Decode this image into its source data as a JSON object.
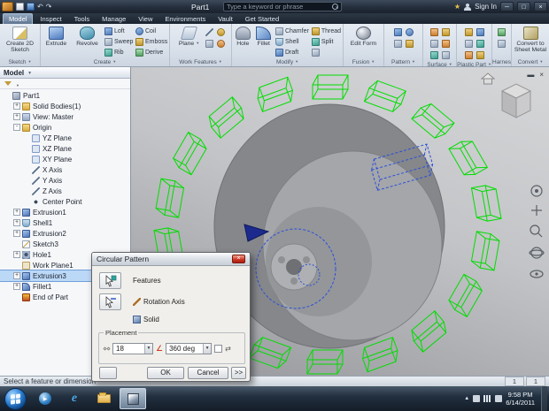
{
  "window": {
    "title": "Part1",
    "search_placeholder": "Type a keyword or phrase",
    "sign_in": "Sign In"
  },
  "icons": {
    "window_min": "─",
    "window_max": "□",
    "window_close": "×",
    "doc_min": "▬",
    "doc_close": "×",
    "undo": "↶",
    "redo": "↷",
    "star": "★",
    "dialog_close": "×",
    "diamonds": "⋄⋄",
    "angle": "∠",
    "flip_arrows": "⇄",
    "combo_arrow": "▼",
    "tray_expand": "▲",
    "play": "▶"
  },
  "tabs": [
    {
      "label": "Model",
      "active": true
    },
    {
      "label": "Inspect"
    },
    {
      "label": "Tools"
    },
    {
      "label": "Manage"
    },
    {
      "label": "View"
    },
    {
      "label": "Environments"
    },
    {
      "label": "Vault"
    },
    {
      "label": "Get Started"
    }
  ],
  "ribbon": {
    "sketch": {
      "label": "Sketch",
      "create_2d_sketch": "Create 2D Sketch"
    },
    "create": {
      "label": "Create",
      "extrude": "Extrude",
      "revolve": "Revolve",
      "loft": "Loft",
      "sweep": "Sweep",
      "rib": "Rib",
      "coil": "Coil",
      "emboss": "Emboss",
      "derive": "Derive"
    },
    "work_features": {
      "label": "Work Features",
      "plane": "Plane"
    },
    "modify": {
      "label": "Modify",
      "hole": "Hole",
      "fillet": "Fillet",
      "chamfer": "Chamfer",
      "thread": "Thread",
      "shell": "Shell",
      "split": "Split",
      "draft": "Draft"
    },
    "fusion": {
      "label": "Fusion",
      "edit_form": "Edit Form"
    },
    "pattern": {
      "label": "Pattern"
    },
    "surface": {
      "label": "Surface"
    },
    "plastic": {
      "label": "Plastic Part"
    },
    "harness": {
      "label": "Harness"
    },
    "convert": {
      "label": "Convert",
      "sheet_metal": "Convert to Sheet Metal"
    }
  },
  "browser": {
    "header": "Model",
    "items": [
      {
        "label": "Part1",
        "level": 0,
        "expand": "",
        "icon": "part"
      },
      {
        "label": "Solid Bodies(1)",
        "level": 1,
        "expand": "+",
        "icon": "folder"
      },
      {
        "label": "View: Master",
        "level": 1,
        "expand": "+",
        "icon": "view"
      },
      {
        "label": "Origin",
        "level": 1,
        "expand": "-",
        "icon": "folder"
      },
      {
        "label": "YZ Plane",
        "level": 2,
        "expand": "",
        "icon": "plane"
      },
      {
        "label": "XZ Plane",
        "level": 2,
        "expand": "",
        "icon": "plane"
      },
      {
        "label": "XY Plane",
        "level": 2,
        "expand": "",
        "icon": "plane"
      },
      {
        "label": "X Axis",
        "level": 2,
        "expand": "",
        "icon": "axis"
      },
      {
        "label": "Y Axis",
        "level": 2,
        "expand": "",
        "icon": "axis"
      },
      {
        "label": "Z Axis",
        "level": 2,
        "expand": "",
        "icon": "axis"
      },
      {
        "label": "Center Point",
        "level": 2,
        "expand": "",
        "icon": "point"
      },
      {
        "label": "Extrusion1",
        "level": 1,
        "expand": "+",
        "icon": "extrude"
      },
      {
        "label": "Shell1",
        "level": 1,
        "expand": "+",
        "icon": "shell"
      },
      {
        "label": "Extrusion2",
        "level": 1,
        "expand": "+",
        "icon": "extrude"
      },
      {
        "label": "Sketch3",
        "level": 1,
        "expand": "",
        "icon": "sketch"
      },
      {
        "label": "Hole1",
        "level": 1,
        "expand": "+",
        "icon": "hole"
      },
      {
        "label": "Work Plane1",
        "level": 1,
        "expand": "",
        "icon": "workplane"
      },
      {
        "label": "Extrusion3",
        "level": 1,
        "expand": "+",
        "icon": "extrude",
        "selected": true
      },
      {
        "label": "Fillet1",
        "level": 1,
        "expand": "+",
        "icon": "fillet"
      },
      {
        "label": "End of Part",
        "level": 1,
        "expand": "",
        "icon": "eop"
      }
    ]
  },
  "dialog": {
    "title": "Circular Pattern",
    "features_label": "Features",
    "rotation_axis_label": "Rotation Axis",
    "solid_label": "Solid",
    "placement_label": "Placement",
    "count_value": "18",
    "angle_value": "360 deg",
    "ok_label": "OK",
    "cancel_label": "Cancel",
    "more_label": ">>"
  },
  "status": {
    "message": "Select a feature or dimension",
    "cell1": "1",
    "cell2": "1"
  },
  "taskbar": {
    "time": "9:58 PM",
    "date": "6/14/2011"
  },
  "viewport": {
    "wireframe_color": "#00dd00",
    "selection_color": "#2b4fd8"
  }
}
